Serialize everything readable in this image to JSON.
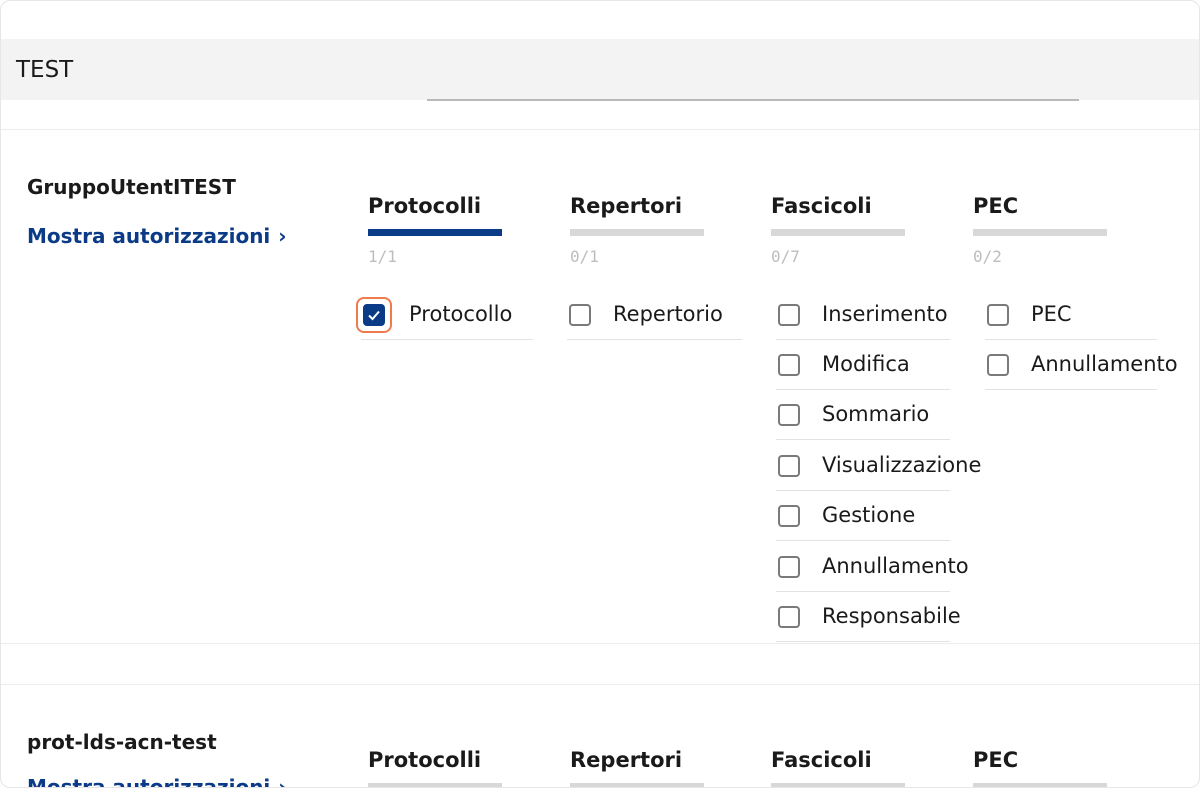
{
  "header": {
    "title": "TEST"
  },
  "groups": [
    {
      "name": "GruppoUtentITEST",
      "show_link": "Mostra autorizzazioni",
      "tabs": [
        {
          "label": "Protocolli",
          "count": "1/1",
          "active": true
        },
        {
          "label": "Repertori",
          "count": "0/1",
          "active": false
        },
        {
          "label": "Fascicoli",
          "count": "0/7",
          "active": false
        },
        {
          "label": "PEC",
          "count": "0/2",
          "active": false
        }
      ],
      "protocolli": [
        {
          "label": "Protocollo",
          "checked": true
        }
      ],
      "repertori": [
        {
          "label": "Repertorio",
          "checked": false
        }
      ],
      "fascicoli": [
        {
          "label": "Inserimento",
          "checked": false
        },
        {
          "label": "Modifica",
          "checked": false
        },
        {
          "label": "Sommario",
          "checked": false
        },
        {
          "label": "Visualizzazione",
          "checked": false
        },
        {
          "label": "Gestione",
          "checked": false
        },
        {
          "label": "Annullamento",
          "checked": false
        },
        {
          "label": "Responsabile",
          "checked": false
        }
      ],
      "pec": [
        {
          "label": "PEC",
          "checked": false
        },
        {
          "label": "Annullamento",
          "checked": false
        }
      ]
    },
    {
      "name": "prot-lds-acn-test",
      "show_link": "Mostra autorizzazioni",
      "tabs": [
        {
          "label": "Protocolli"
        },
        {
          "label": "Repertori"
        },
        {
          "label": "Fascicoli"
        },
        {
          "label": "PEC"
        }
      ]
    }
  ],
  "colors": {
    "accent": "#0b3a87",
    "focus": "#ef7b4d",
    "tab_inactive": "#d8d8d8"
  }
}
